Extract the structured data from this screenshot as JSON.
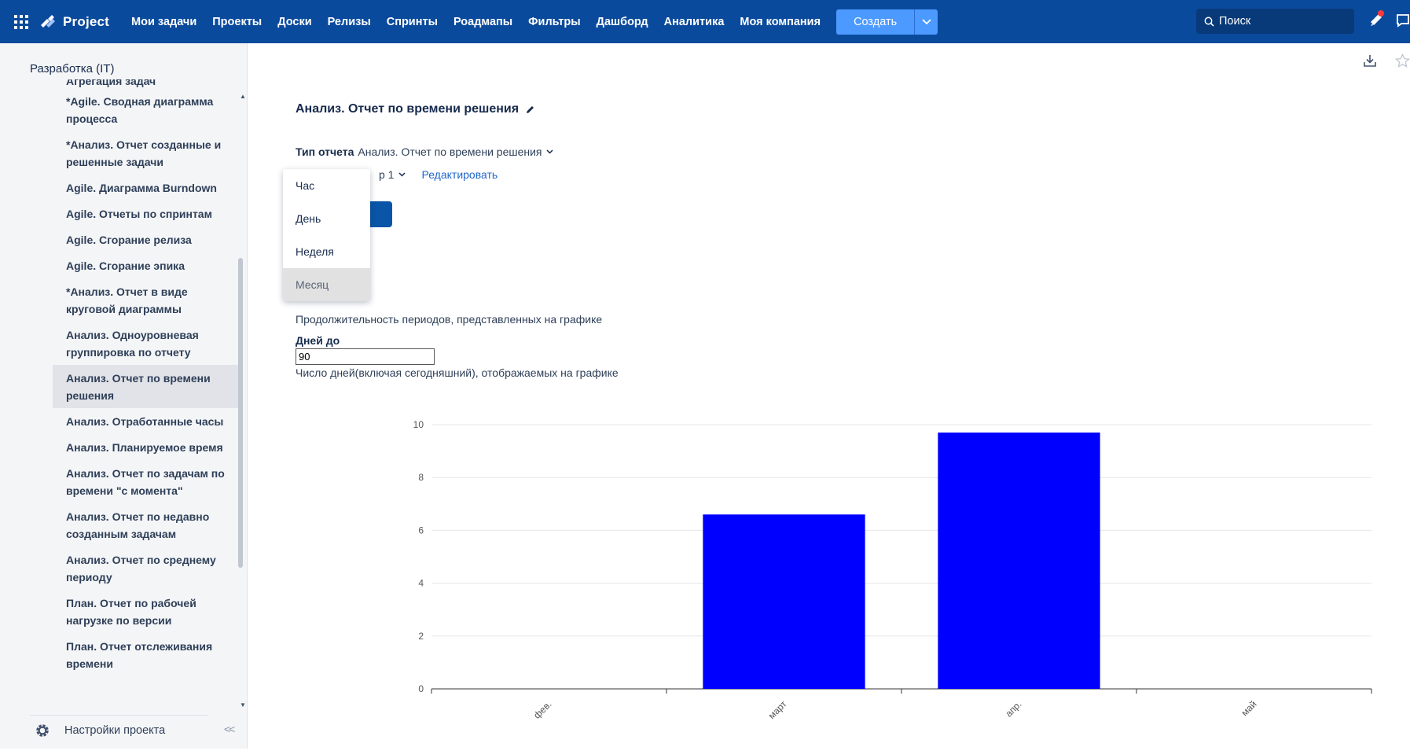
{
  "topnav": {
    "logo": "Project",
    "items": [
      "Мои задачи",
      "Проекты",
      "Доски",
      "Релизы",
      "Спринты",
      "Роадмапы",
      "Фильтры",
      "Дашборд",
      "Аналитика",
      "Моя компания"
    ],
    "create_label": "Создать",
    "search_placeholder": "Поиск"
  },
  "sidebar": {
    "project_name": "Разработка (IT)",
    "cut_item": "Агрегация задач",
    "items": [
      "*Agile. Сводная диаграмма процесса",
      "*Анализ. Отчет созданные и решенные задачи",
      "Agile. Диаграмма Burndown",
      "Agile. Отчеты по спринтам",
      "Agile. Сгорание релиза",
      "Agile. Сгорание эпика",
      "*Анализ. Отчет в виде круговой диаграммы",
      "Анализ. Одноуровневая группировка по отчету",
      "Анализ. Отчет по времени решения",
      "Анализ. Отработанные часы",
      "Анализ. Планируемое время",
      "Анализ. Отчет по задачам по времени \"с момента\"",
      "Анализ. Отчет по недавно созданным задачам",
      "Анализ. Отчет по среднему периоду",
      "План. Отчет по рабочей нагрузке по версии",
      "План. Отчет отслеживания времени"
    ],
    "active_index": 8,
    "settings_label": "Настройки проекта"
  },
  "main": {
    "title": "Анализ. Отчет по времени решения",
    "report_type_label": "Тип отчета",
    "report_type_value": "Анализ. Отчет по времени решения",
    "filter_value": "р 1",
    "edit_label": "Редактировать",
    "period_options": [
      "Час",
      "День",
      "Неделя",
      "Месяц"
    ],
    "period_selected": "Месяц",
    "period_description": "Продолжительность периодов, представленных на графике",
    "days_label": "Дней до",
    "days_value": "90",
    "days_description": "Число дней(включая сегодняшний), отображаемых на графике"
  },
  "chart_data": {
    "type": "bar",
    "categories": [
      "фев.",
      "март",
      "апр.",
      "май"
    ],
    "values": [
      0,
      6.6,
      9.7,
      0
    ],
    "ylim": [
      0,
      10
    ],
    "yticks": [
      0,
      2,
      4,
      6,
      8,
      10
    ],
    "bar_color": "#0000ff",
    "grid": true
  },
  "colors": {
    "nav_bg": "#0a4a9c",
    "create_btn": "#4c9aff",
    "link": "#1f66c8",
    "bar": "#0000ff"
  }
}
